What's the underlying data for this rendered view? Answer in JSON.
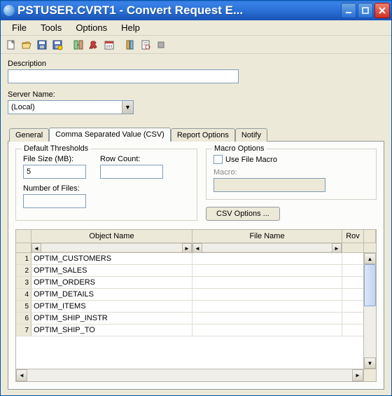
{
  "window": {
    "title": "PSTUSER.CVRT1 - Convert Request E..."
  },
  "menu": {
    "file": "File",
    "tools": "Tools",
    "options": "Options",
    "help": "Help"
  },
  "labels": {
    "description": "Description",
    "server_name": "Server Name:",
    "default_thresholds": "Default Thresholds",
    "file_size": "File Size (MB):",
    "row_count": "Row Count:",
    "number_of_files": "Number of Files:",
    "macro_options": "Macro Options",
    "use_file_macro": "Use File Macro",
    "macro": "Macro:",
    "csv_options": "CSV Options ..."
  },
  "values": {
    "description": "",
    "server_name": "(Local)",
    "file_size": "5",
    "row_count": "",
    "number_of_files": "",
    "use_file_macro_checked": false,
    "macro": ""
  },
  "tabs": {
    "general": "General",
    "csv": "Comma Separated Value (CSV)",
    "report": "Report Options",
    "notify": "Notify",
    "active": "csv"
  },
  "grid": {
    "headers": {
      "object_name": "Object Name",
      "file_name": "File Name",
      "rov": "Rov"
    },
    "rows": [
      {
        "n": 1,
        "object_name": "OPTIM_CUSTOMERS",
        "file_name": "",
        "rov": ""
      },
      {
        "n": 2,
        "object_name": "OPTIM_SALES",
        "file_name": "",
        "rov": ""
      },
      {
        "n": 3,
        "object_name": "OPTIM_ORDERS",
        "file_name": "",
        "rov": ""
      },
      {
        "n": 4,
        "object_name": "OPTIM_DETAILS",
        "file_name": "",
        "rov": ""
      },
      {
        "n": 5,
        "object_name": "OPTIM_ITEMS",
        "file_name": "",
        "rov": ""
      },
      {
        "n": 6,
        "object_name": "OPTIM_SHIP_INSTR",
        "file_name": "",
        "rov": ""
      },
      {
        "n": 7,
        "object_name": "OPTIM_SHIP_TO",
        "file_name": "",
        "rov": ""
      }
    ]
  }
}
